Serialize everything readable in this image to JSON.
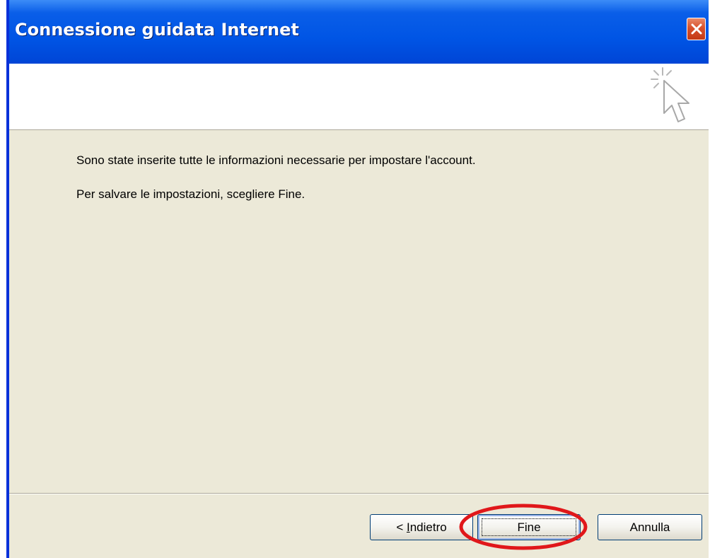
{
  "window": {
    "title": "Connessione guidata Internet"
  },
  "icons": {
    "close": "close-icon",
    "wizard": "cursor-sparkle-icon"
  },
  "body": {
    "line1": "Sono state inserite tutte le informazioni necessarie per impostare l'account.",
    "line2": "Per salvare le impostazioni, scegliere Fine."
  },
  "buttons": {
    "back_prefix": "< ",
    "back_mnemonic": "I",
    "back_rest": "ndietro",
    "finish": "Fine",
    "cancel": "Annulla"
  },
  "colors": {
    "titlebar": "#0055e5",
    "dialog_background": "#ece9d8",
    "close_button": "#d8512c",
    "highlight_annotation": "#e0171a"
  }
}
